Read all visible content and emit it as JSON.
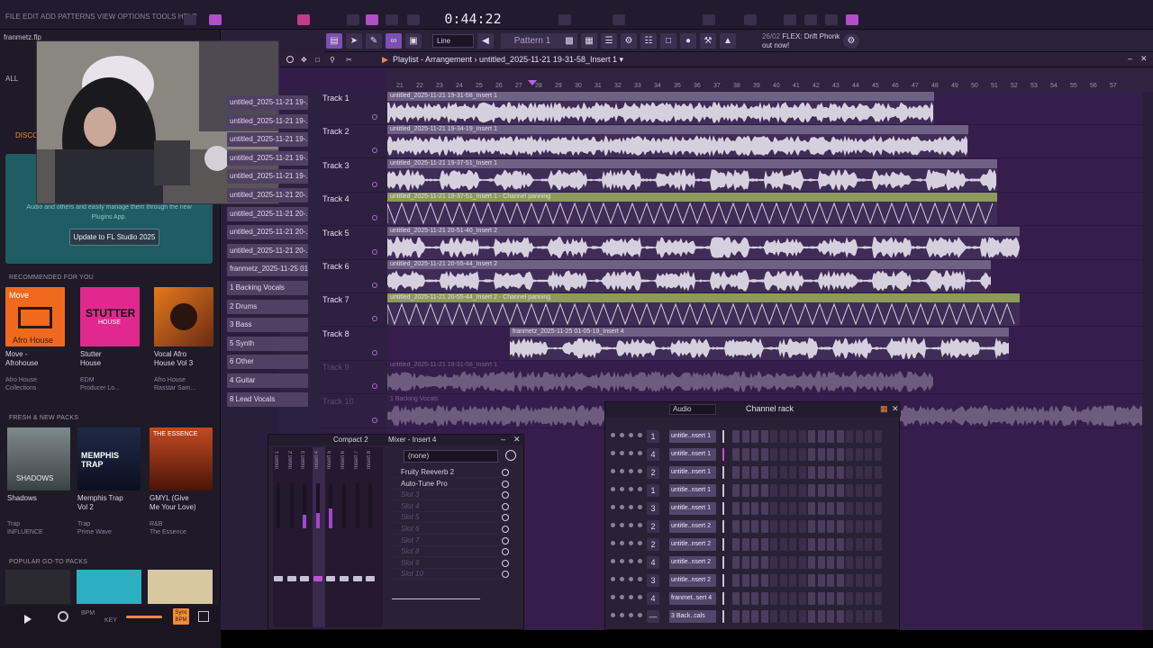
{
  "app": {
    "menu": "FILE EDIT ADD PATTERNS VIEW OPTIONS TOOLS HELP",
    "time": "0:44:22",
    "pattern": "Pattern 1",
    "snap": "Line",
    "news_date": "26/02",
    "news_text": "FLEX: Drift Phonk",
    "news_sub": "out now!"
  },
  "browser": {
    "file": "franmetz.flp",
    "tab_all": "ALL",
    "tab_discover": "DISCO",
    "update_text": "Audio and others and easily manage them through the new Plugins App.",
    "update_button": "Update to FL Studio 2025",
    "sections": {
      "recommended": "RECOMMENDED FOR YOU",
      "fresh": "FRESH & NEW PACKS",
      "popular": "POPULAR GO-TO PACKS"
    },
    "recommended": [
      {
        "name": "Move -",
        "name2": "Afrohouse",
        "genre": "Afro House",
        "genre2": "Collections",
        "art_text": "Move",
        "art_sub": "Afro House"
      },
      {
        "name": "Stutter",
        "name2": "House",
        "genre": "EDM",
        "genre2": "Producer Lo...",
        "art_text": "STUTTER",
        "art_sub": "HOUSE"
      },
      {
        "name": "Vocal Afro",
        "name2": "House Vol 3",
        "genre": "Afro House",
        "genre2": "Rasstar Sam...",
        "art_text": "",
        "art_sub": ""
      }
    ],
    "fresh": [
      {
        "name": "Shadows",
        "name2": "",
        "genre": "Trap",
        "genre2": "INFLUENCE",
        "art_text": "SHADOWS"
      },
      {
        "name": "Memphis Trap",
        "name2": "Vol 2",
        "genre": "Trap",
        "genre2": "Prime Wave",
        "art_text": "MEMPHIS TRAP"
      },
      {
        "name": "GMYL (Give",
        "name2": "Me Your Love)",
        "genre": "R&B",
        "genre2": "The Essence",
        "art_text": "THE ESSENCE"
      }
    ],
    "bpm_label": "BPM",
    "key_label": "KEY",
    "sync_label": "Sync BPM"
  },
  "playlist": {
    "title": "Playlist - Arrangement › untitled_2025-11-21 19-31-58_Insert 1 ▾",
    "ruler": [
      "21",
      "22",
      "23",
      "24",
      "25",
      "26",
      "27",
      "28",
      "29",
      "30",
      "31",
      "32",
      "33",
      "34",
      "35",
      "36",
      "37",
      "38",
      "39",
      "40",
      "41",
      "42",
      "43",
      "44",
      "45",
      "46",
      "47",
      "48",
      "49",
      "50",
      "51",
      "52",
      "53",
      "54",
      "55",
      "56",
      "57"
    ],
    "tracks": [
      "Track 1",
      "Track 2",
      "Track 3",
      "Track 4",
      "Track 5",
      "Track 6",
      "Track 7",
      "Track 8",
      "Track 9",
      "Track 10"
    ],
    "side_clips": [
      "untitled_2025-11-21 19-...",
      "untitled_2025-11-21 19-...",
      "untitled_2025-11-21 19-...",
      "untitled_2025-11-21 19-...",
      "untitled_2025-11-21 19-...",
      "untitled_2025-11-21 20-...",
      "untitled_2025-11-21 20-...",
      "untitled_2025-11-21 20-...",
      "untitled_2025-11-21 20-...",
      "franmetz_2025-11-25 01...",
      "1 Backing Vocals",
      "2 Drums",
      "3 Bass",
      "5 Synth",
      "6 Other",
      "4 Guitar",
      "8 Lead Vocals"
    ],
    "clips": [
      {
        "label": "untitled_2025-11-21 19-31-58_Insert 1"
      },
      {
        "label": "untitled_2025-11-21 19-34-19_Insert 1"
      },
      {
        "label": "untitled_2025-11-21 19-37-51_Insert 1"
      },
      {
        "label": "untitled_2025-11-21 19-37-51_Insert 1 - Channel panning"
      },
      {
        "label": "untitled_2025-11-21 20-51-40_Insert 2"
      },
      {
        "label": "untitled_2025-11-21 20-55-44_Insert 2"
      },
      {
        "label": "untitled_2025-11-21 20-55-44_Insert 2 - Channel panning"
      },
      {
        "label": "franmetz_2025-11-25 01-05-19_Insert 4"
      },
      {
        "label": "untitled_2025-11-21 19-31-58_Insert 1"
      },
      {
        "label": "1 Backing Vocals"
      }
    ]
  },
  "mixer": {
    "preset": "Compact 2",
    "title": "Mixer - Insert 4",
    "strips": [
      "Insert 1",
      "Insert 2",
      "Insert 3",
      "Insert 4",
      "Insert 5",
      "Insert 6",
      "Insert 7",
      "Insert 8"
    ],
    "fx_select": "(none)",
    "slots": [
      "Fruity Reeverb 2",
      "Auto-Tune Pro",
      "Slot 3",
      "Slot 4",
      "Slot 5",
      "Slot 6",
      "Slot 7",
      "Slot 8",
      "Slot 9",
      "Slot 10"
    ]
  },
  "channel_rack": {
    "filter": "Audio",
    "title": "Channel rack",
    "rows": [
      {
        "num": "1",
        "name": "untitle..nsert 1"
      },
      {
        "num": "4",
        "name": "untitle..nsert 1"
      },
      {
        "num": "2",
        "name": "untitle..nsert 1"
      },
      {
        "num": "1",
        "name": "untitle..nsert 1"
      },
      {
        "num": "3",
        "name": "untitle..nsert 1"
      },
      {
        "num": "2",
        "name": "untitle..nsert 2"
      },
      {
        "num": "2",
        "name": "untitle..nsert 2"
      },
      {
        "num": "4",
        "name": "untitle..nsert 2"
      },
      {
        "num": "3",
        "name": "untitle..nsert 2"
      },
      {
        "num": "4",
        "name": "franmet..sert 4"
      },
      {
        "num": "—",
        "name": "3 Back..cals"
      }
    ]
  },
  "colors": {
    "accent": "#f08b3a",
    "playlist_bg": "#361e4c",
    "clip_header": "#6f6184",
    "automation_header": "#8c9a5c",
    "waveform": "#d6d0de"
  }
}
